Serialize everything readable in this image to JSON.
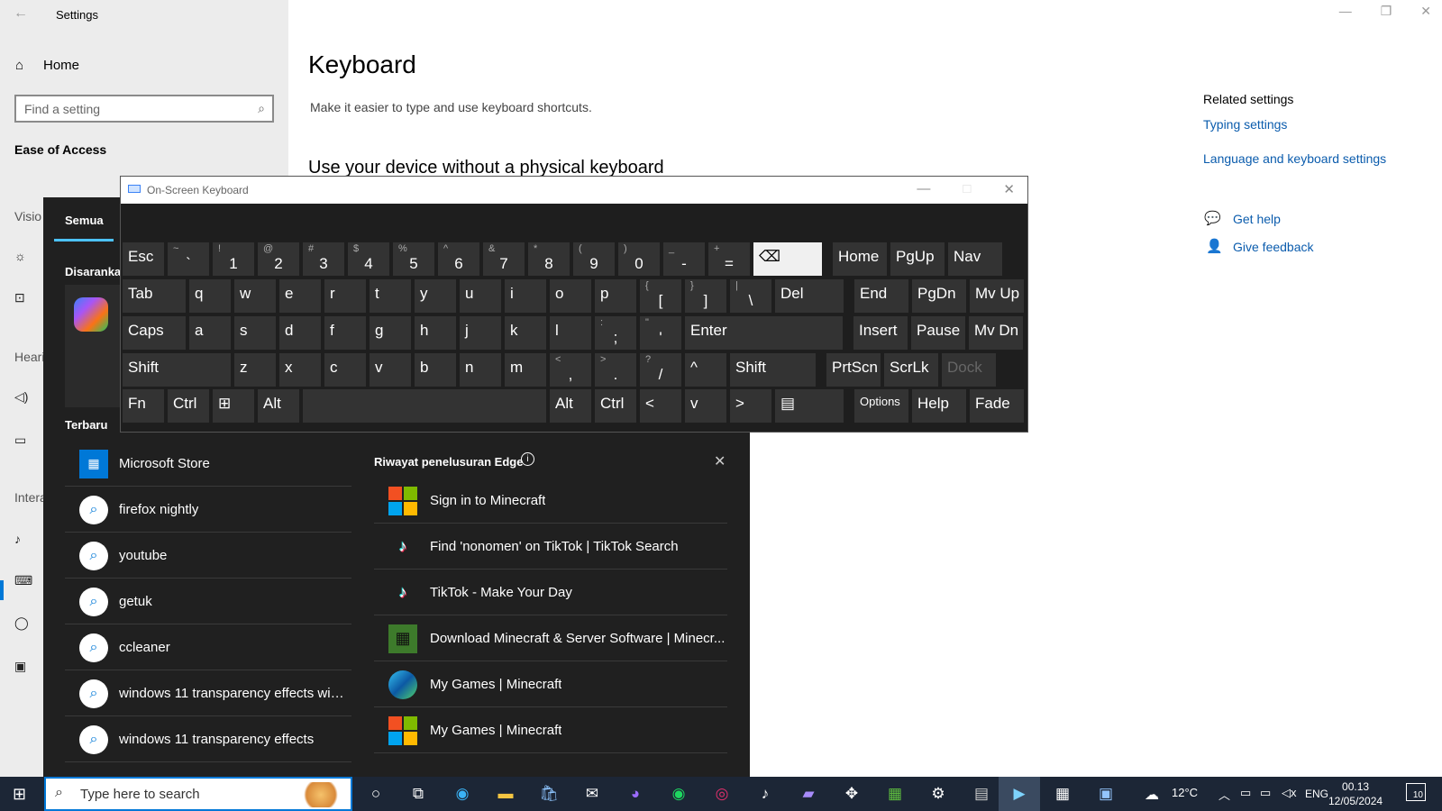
{
  "settings": {
    "window_title": "Settings",
    "home_label": "Home",
    "search_placeholder": "Find a setting",
    "section_label": "Ease of Access",
    "page_title": "Keyboard",
    "page_description": "Make it easier to type and use keyboard shortcuts.",
    "subheading": "Use your device without a physical keyboard",
    "related_title": "Related settings",
    "related_links": [
      "Typing settings",
      "Language and keyboard settings"
    ],
    "get_help": "Get help",
    "give_feedback": "Give feedback",
    "sidebar_partial": [
      "Visio",
      "Heari",
      "Intera"
    ]
  },
  "start_menu": {
    "tab_all": "Semua",
    "suggested_label": "Disarankan",
    "recent_label": "Terbaru",
    "recent_items": [
      {
        "label": "Microsoft Store",
        "icon": "store-icon"
      },
      {
        "label": "firefox nightly",
        "icon": "search-icon"
      },
      {
        "label": "youtube",
        "icon": "search-icon"
      },
      {
        "label": "getuk",
        "icon": "search-icon"
      },
      {
        "label": "ccleaner",
        "icon": "search-icon"
      },
      {
        "label": "windows 11 transparency effects win...",
        "icon": "search-icon"
      },
      {
        "label": "windows 11 transparency effects",
        "icon": "search-icon"
      }
    ],
    "edge_history_title": "Riwayat penelusuran Edge",
    "edge_items": [
      {
        "label": "Sign in to Minecraft",
        "icon": "microsoft-logo-icon"
      },
      {
        "label": "Find 'nonomen' on TikTok | TikTok Search",
        "icon": "tiktok-icon"
      },
      {
        "label": "TikTok - Make Your Day",
        "icon": "tiktok-icon"
      },
      {
        "label": "Download Minecraft & Server Software | Minecr...",
        "icon": "minecraft-icon"
      },
      {
        "label": "My Games | Minecraft",
        "icon": "edge-icon"
      },
      {
        "label": "My Games | Minecraft",
        "icon": "microsoft-logo-icon"
      }
    ]
  },
  "osk": {
    "title": "On-Screen Keyboard",
    "rows": [
      [
        {
          "m": "Esc"
        },
        {
          "s": "~",
          "l": "`"
        },
        {
          "s": "!",
          "l": "1"
        },
        {
          "s": "@",
          "l": "2"
        },
        {
          "s": "#",
          "l": "3"
        },
        {
          "s": "$",
          "l": "4"
        },
        {
          "s": "%",
          "l": "5"
        },
        {
          "s": "^",
          "l": "6"
        },
        {
          "s": "&",
          "l": "7"
        },
        {
          "s": "*",
          "l": "8"
        },
        {
          "s": "(",
          "l": "9"
        },
        {
          "s": ")",
          "l": "0"
        },
        {
          "s": "_",
          "l": "-"
        },
        {
          "s": "+",
          "l": "="
        },
        {
          "m": "⌫"
        },
        {
          "m": "Home"
        },
        {
          "m": "PgUp"
        },
        {
          "m": "Nav"
        }
      ],
      [
        {
          "m": "Tab"
        },
        {
          "m": "q"
        },
        {
          "m": "w"
        },
        {
          "m": "e"
        },
        {
          "m": "r"
        },
        {
          "m": "t"
        },
        {
          "m": "y"
        },
        {
          "m": "u"
        },
        {
          "m": "i"
        },
        {
          "m": "o"
        },
        {
          "m": "p"
        },
        {
          "s": "{",
          "l": "["
        },
        {
          "s": "}",
          "l": "]"
        },
        {
          "s": "|",
          "l": "\\"
        },
        {
          "m": "Del"
        },
        {
          "m": "End"
        },
        {
          "m": "PgDn"
        },
        {
          "m": "Mv Up"
        }
      ],
      [
        {
          "m": "Caps"
        },
        {
          "m": "a"
        },
        {
          "m": "s"
        },
        {
          "m": "d"
        },
        {
          "m": "f"
        },
        {
          "m": "g"
        },
        {
          "m": "h"
        },
        {
          "m": "j"
        },
        {
          "m": "k"
        },
        {
          "m": "l"
        },
        {
          "s": ":",
          "l": ";"
        },
        {
          "s": "\"",
          "l": "'"
        },
        {
          "m": "Enter"
        },
        {
          "m": "Insert"
        },
        {
          "m": "Pause"
        },
        {
          "m": "Mv Dn"
        }
      ],
      [
        {
          "m": "Shift"
        },
        {
          "m": "z"
        },
        {
          "m": "x"
        },
        {
          "m": "c"
        },
        {
          "m": "v"
        },
        {
          "m": "b"
        },
        {
          "m": "n"
        },
        {
          "m": "m"
        },
        {
          "s": "<",
          "l": ","
        },
        {
          "s": ">",
          "l": "."
        },
        {
          "s": "?",
          "l": "/"
        },
        {
          "m": "^"
        },
        {
          "m": "Shift"
        },
        {
          "m": "PrtScn"
        },
        {
          "m": "ScrLk"
        },
        {
          "m": "Dock"
        }
      ],
      [
        {
          "m": "Fn"
        },
        {
          "m": "Ctrl"
        },
        {
          "m": "⊞"
        },
        {
          "m": "Alt"
        },
        {
          "m": ""
        },
        {
          "m": "Alt"
        },
        {
          "m": "Ctrl"
        },
        {
          "m": "<"
        },
        {
          "m": "v"
        },
        {
          "m": ">"
        },
        {
          "m": "▤"
        },
        {
          "m": "Options"
        },
        {
          "m": "Help"
        },
        {
          "m": "Fade"
        }
      ]
    ]
  },
  "taskbar": {
    "search_placeholder": "Type here to search",
    "temperature": "12°C",
    "language": "ENG",
    "time": "00.13",
    "date": "12/05/2024",
    "notifications": "10"
  }
}
